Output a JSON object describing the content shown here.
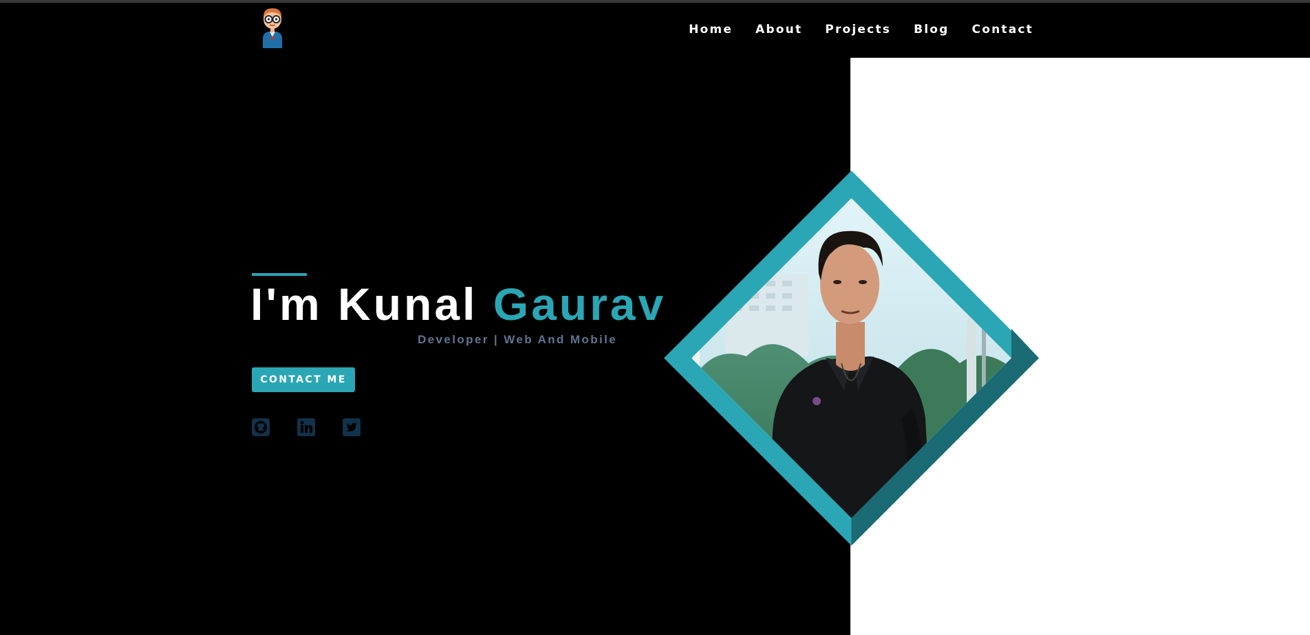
{
  "nav": {
    "items": [
      {
        "label": "Home"
      },
      {
        "label": "About"
      },
      {
        "label": "Projects"
      },
      {
        "label": "Blog"
      },
      {
        "label": "Contact"
      }
    ]
  },
  "hero": {
    "title_prefix": "I'm Kunal ",
    "title_highlight": "Gaurav",
    "subtitle": "Developer | Web And Mobile",
    "cta_label": "CONTACT ME"
  },
  "social": {
    "icons": [
      "github-icon",
      "linkedin-icon",
      "twitter-icon"
    ]
  },
  "colors": {
    "accent": "#2aa6b4",
    "accent_dark": "#1a6b73",
    "subtitle": "#5f7590",
    "social_icon": "#11324a",
    "background": "#000000",
    "panel": "#ffffff"
  }
}
